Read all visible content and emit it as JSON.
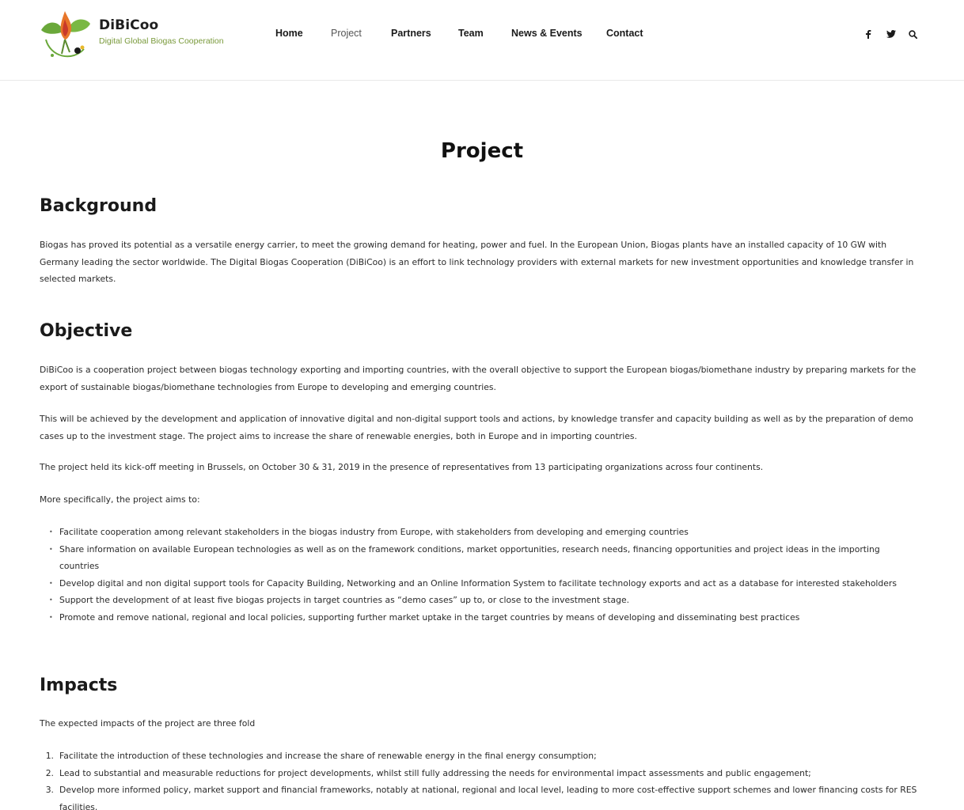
{
  "brand": {
    "name": "DiBiCoo",
    "tagline": "Digital Global Biogas Cooperation"
  },
  "nav": {
    "items": [
      {
        "label": "Home"
      },
      {
        "label": "Project"
      },
      {
        "label": "Partners"
      },
      {
        "label": "Team"
      },
      {
        "label": "News & Events"
      },
      {
        "label": "Contact"
      }
    ],
    "active": "Project"
  },
  "header_icons": [
    "facebook-icon",
    "twitter-icon",
    "search-icon"
  ],
  "colors": {
    "tagline_green": "#7a9a3c",
    "leaf_green": "#6aa83a",
    "flame_orange": "#e8762a",
    "flame_red": "#c83a2a"
  },
  "page": {
    "title": "Project"
  },
  "background": {
    "heading": "Background",
    "text": "Biogas has proved its potential as a versatile energy carrier, to meet the growing demand for heating, power and fuel. In the European Union, Biogas plants have an installed capacity of 10 GW with Germany leading the sector worldwide. The Digital Biogas Cooperation (DiBiCoo) is an effort to link technology providers with external markets for new investment opportunities and knowledge transfer in selected markets."
  },
  "objective": {
    "heading": "Objective",
    "p1": "DiBiCoo is a cooperation project between biogas technology exporting and importing countries, with the overall objective to support the European biogas/biomethane industry by prepar­ing markets for the export of sustainable biogas/biomethane technologies from Europe to developing and emerging countries.",
    "p2": "This will be achieved by the development and application of innovative digital and non-digital support tools and actions, by knowledge transfer and capacity building as well as by the prep­aration of demo cases up to the investment stage. The project aims to increase the share of renewable energies, both in Europe and in importing countries.",
    "p3": "The project held its kick-off meeting in Brussels, on October 30 & 31, 2019 in the presence of representatives from 13 participating organizations across four continents.",
    "p4": "More specifically, the project aims to:",
    "aims": [
      "Facilitate cooperation among relevant stakeholders in the biogas industry from Europe, with stakeholders from developing and emerging countries",
      "Share information on available European technologies as well as on the framework conditions, market opportunities, research needs, financing opportunities and project ideas in the importing countries",
      "Develop digital and non digital support tools for Capacity Building, Networking and an Online Information System to facilitate technology exports and act as a database for interested stakeholders",
      "Support the development of at least five biogas projects in target countries as “demo cases” up to, or close to the investment stage.",
      "Promote and remove national, regional and local policies, supporting further market uptake in the target countries by means of developing and disseminating best practices"
    ]
  },
  "impacts": {
    "heading": "Impacts",
    "intro": "The expected impacts of the project are three fold",
    "items": [
      "Facilitate the introduction of these technologies and increase the share of renewable energy in the final energy consumption;",
      "Lead to substantial and measurable reductions for project developments, whilst still fully addressing the needs for environmental impact assessments and public engagement;",
      "Develop more informed policy, market support and financial frameworks, notably at national, regional and local level, leading to more cost-effective support schemes and lower financ­ing costs for RES facilities."
    ]
  }
}
